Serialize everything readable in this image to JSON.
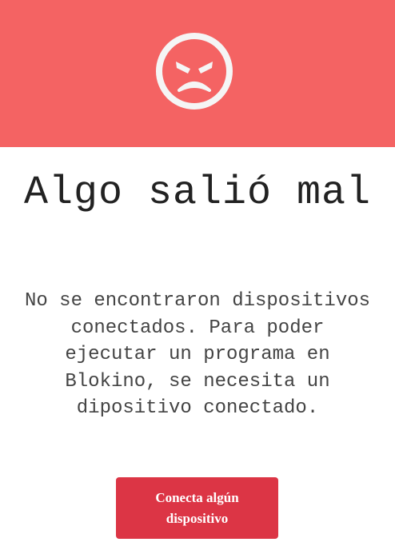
{
  "header": {
    "background_color": "#f46363",
    "icon": "angry-face-icon"
  },
  "error": {
    "title": "Algo salió mal",
    "message": "No se encontraron dispositivos conectados. Para poder ejecutar un programa en Blokino, se necesita un dipositivo conectado."
  },
  "action": {
    "button_label": "Conecta algún dispositivo",
    "button_color": "#dc3545"
  }
}
